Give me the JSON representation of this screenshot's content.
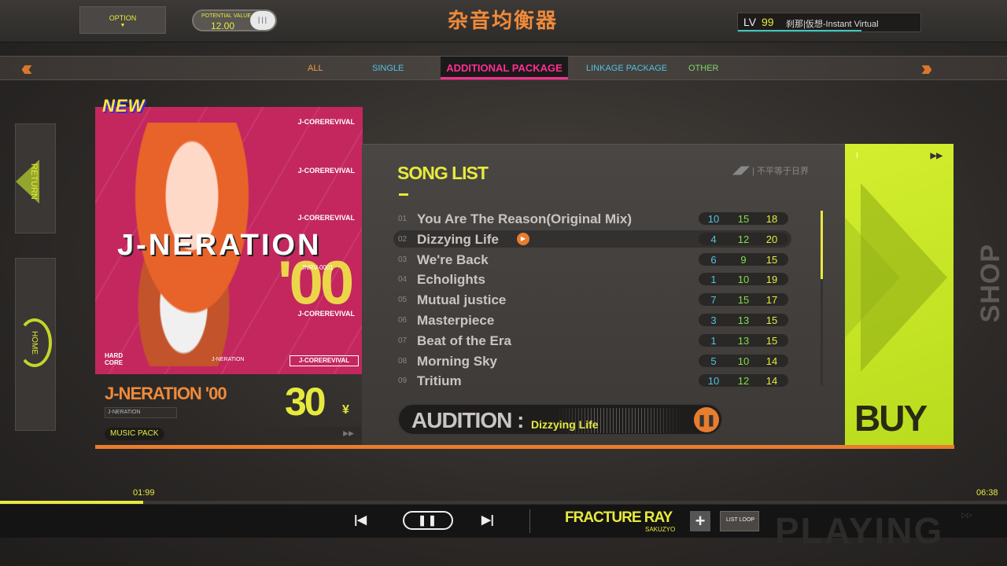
{
  "header": {
    "option_label": "OPTION",
    "option_arrow": "▼",
    "potential_label": "POTENTIAL VALUE",
    "potential_value": "12.00",
    "potential_pill": "III",
    "logo_text": "杂音均衡器",
    "level_label": "LV",
    "level_value": "99",
    "player_name": "刹那|仮想-Instant Virtual",
    "exp_fraction": 0.67
  },
  "tabs": {
    "all": "ALL",
    "single": "SINGLE",
    "additional": "ADDITIONAL PACKAGE",
    "linkage": "LINKAGE PACKAGE",
    "other": "OTHER",
    "chevron_left": "‹‹‹",
    "chevron_right": "›››"
  },
  "side": {
    "return_label": "RETURN",
    "home_label": "HOME"
  },
  "pack": {
    "new_badge": "NEW",
    "cover_title": "J-NERATION",
    "cover_number": "'00",
    "cover_code": "JNRV-0001",
    "cover_brand": "J-COREREVIVAL",
    "cover_hardcore": "HARD CORE",
    "cover_small_title": "J-NERATION",
    "name": "J-NERATION '00",
    "subtitle": "J-NERATION",
    "type_badge": "MUSIC PACK",
    "price": "30",
    "price_unit": "¥",
    "play_icon": "▶▶"
  },
  "songlist": {
    "title": "SONG LIST",
    "brand": "◢◤ | 不平等于日界",
    "scroll_fraction": 0.39,
    "songs": [
      {
        "num": "01",
        "name": "You Are The Reason(Original Mix)",
        "easy": "10",
        "normal": "15",
        "hard": "18",
        "selected": false
      },
      {
        "num": "02",
        "name": "Dizzying Life",
        "easy": "4",
        "normal": "12",
        "hard": "20",
        "selected": true
      },
      {
        "num": "03",
        "name": "We're Back",
        "easy": "6",
        "normal": "9",
        "hard": "15",
        "selected": false
      },
      {
        "num": "04",
        "name": "Echolights",
        "easy": "1",
        "normal": "10",
        "hard": "19",
        "selected": false
      },
      {
        "num": "05",
        "name": "Mutual justice",
        "easy": "7",
        "normal": "15",
        "hard": "17",
        "selected": false
      },
      {
        "num": "06",
        "name": "Masterpiece",
        "easy": "3",
        "normal": "13",
        "hard": "15",
        "selected": false
      },
      {
        "num": "07",
        "name": "Beat of the Era",
        "easy": "1",
        "normal": "13",
        "hard": "15",
        "selected": false
      },
      {
        "num": "08",
        "name": "Morning Sky",
        "easy": "5",
        "normal": "10",
        "hard": "14",
        "selected": false
      },
      {
        "num": "09",
        "name": "Tritium",
        "easy": "10",
        "normal": "12",
        "hard": "14",
        "selected": false
      }
    ]
  },
  "audition": {
    "label": "AUDITION :",
    "song": "Dizzying Life",
    "pause_icon": "❚❚"
  },
  "buy": {
    "label": "BUY",
    "corner_left": "I",
    "corner_right": "▶▶",
    "shop_text": "SHOP"
  },
  "nowplaying": {
    "time_current": "01:99",
    "time_total": "06:38",
    "progress_fraction": 0.142,
    "prev_icon": "|◀",
    "pause_icon": "❚❚",
    "next_icon": "▶|",
    "title": "FRACTURE RAY",
    "artist": "SAKUZYO",
    "add_icon": "+",
    "loop_label": "LIST LOOP",
    "playing_text": "PLAYING",
    "playing_marker": "▷▷"
  },
  "colors": {
    "accent_yellow": "#e6ea3e",
    "accent_orange": "#e87d2e",
    "accent_pink": "#ff2f8e",
    "buy_green": "#c8e62a",
    "easy_color": "#4fc3e0",
    "normal_color": "#7ddf4a",
    "hard_color": "#e6ea3e"
  }
}
